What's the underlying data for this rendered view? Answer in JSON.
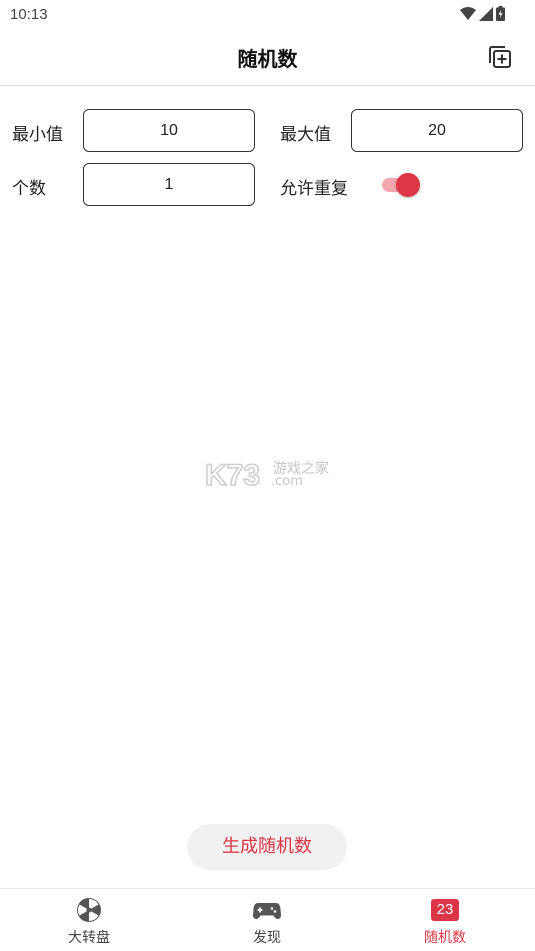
{
  "status_bar": {
    "time": "10:13"
  },
  "app_bar": {
    "title": "随机数"
  },
  "form": {
    "min_label": "最小值",
    "min_value": "10",
    "max_label": "最大值",
    "max_value": "20",
    "count_label": "个数",
    "count_value": "1",
    "allow_repeat_label": "允许重复",
    "allow_repeat_on": true
  },
  "watermark": {
    "brand": "K73",
    "cn": "游戏之家",
    "domain": ".com"
  },
  "generate_button_label": "生成随机数",
  "bottom_nav": {
    "items": [
      {
        "label": "大转盘",
        "icon": "wheel-icon",
        "active": false
      },
      {
        "label": "发现",
        "icon": "gamepad-icon",
        "active": false
      },
      {
        "label": "随机数",
        "icon": "number-badge-icon",
        "badge": "23",
        "active": true
      }
    ]
  },
  "colors": {
    "accent": "#dc3545",
    "toggle_track": "#f4a7ae",
    "button_bg": "#f1f1f1"
  }
}
